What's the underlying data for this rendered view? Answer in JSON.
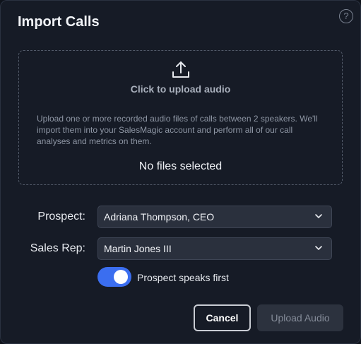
{
  "dialog": {
    "title": "Import Calls",
    "help_icon_glyph": "?"
  },
  "dropzone": {
    "icon": "upload-icon",
    "label": "Click to upload audio",
    "description": "Upload one or more recorded audio files of calls between 2 speakers. We'll import them into your SalesMagic account and perform all of our call analyses and metrics on them.",
    "status": "No files selected"
  },
  "form": {
    "prospect": {
      "label": "Prospect:",
      "value": "Adriana Thompson, CEO"
    },
    "sales_rep": {
      "label": "Sales Rep:",
      "value": "Martin Jones III"
    },
    "toggle": {
      "label": "Prospect speaks first",
      "on": true,
      "color": "#3b6ef0"
    }
  },
  "actions": {
    "cancel_label": "Cancel",
    "upload_label": "Upload Audio"
  }
}
